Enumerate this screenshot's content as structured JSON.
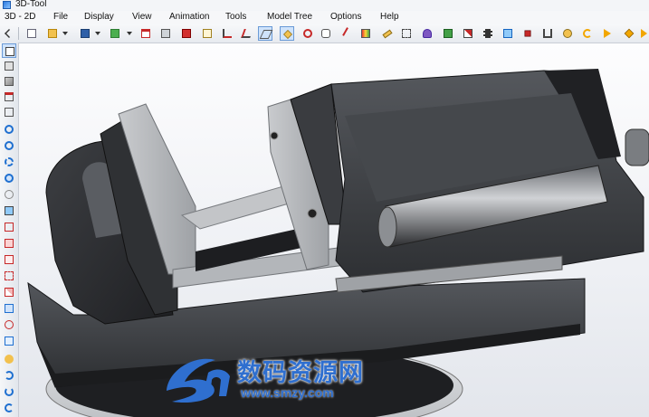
{
  "window": {
    "title": "3D-Tool"
  },
  "menu": [
    {
      "id": "3d2d",
      "label": "3D - 2D"
    },
    {
      "id": "file",
      "label": "File"
    },
    {
      "id": "display",
      "label": "Display"
    },
    {
      "id": "view",
      "label": "View"
    },
    {
      "id": "animation",
      "label": "Animation"
    },
    {
      "id": "tools",
      "label": "Tools"
    },
    {
      "id": "model-tree",
      "label": "Model Tree"
    },
    {
      "id": "options",
      "label": "Options"
    },
    {
      "id": "help",
      "label": "Help"
    }
  ],
  "toolbar": {
    "buttons": [
      {
        "icon": "expand-arrows-icon"
      },
      {
        "icon": "new-document-icon"
      },
      {
        "icon": "open-folder-icon",
        "dropdown": true
      },
      {
        "icon": "save-disk-icon",
        "dropdown": true
      },
      {
        "icon": "export-icon",
        "dropdown": true
      },
      {
        "icon": "pdf-export-icon"
      },
      {
        "icon": "print-icon"
      },
      {
        "icon": "bom-icon"
      },
      {
        "icon": "properties-icon"
      },
      {
        "icon": "measure-edge-icon"
      },
      {
        "icon": "measure-angle-icon"
      },
      {
        "icon": "section-cut-icon",
        "active": true
      },
      {
        "icon": "section-plane-icon",
        "active": true
      },
      {
        "icon": "markup-icon"
      },
      {
        "icon": "comment-icon"
      },
      {
        "icon": "pencil-icon"
      },
      {
        "icon": "color-picker-icon"
      },
      {
        "icon": "ruler-icon"
      },
      {
        "icon": "exploded-view-icon"
      },
      {
        "icon": "paint-brush-icon"
      },
      {
        "icon": "compare-icon"
      },
      {
        "icon": "transform-icon"
      },
      {
        "icon": "film-strip-icon"
      },
      {
        "icon": "snapshot-icon"
      },
      {
        "icon": "assembly-icon"
      },
      {
        "icon": "component-icon"
      },
      {
        "icon": "move-icon"
      },
      {
        "icon": "rotate-icon"
      },
      {
        "icon": "play-forward-icon"
      },
      {
        "icon": "keyframe-diamond-icon"
      },
      {
        "icon": "animation-path-icon"
      }
    ]
  },
  "side_toolbar": {
    "buttons": [
      {
        "icon": "select-icon",
        "selected": true
      },
      {
        "icon": "view-front-icon"
      },
      {
        "icon": "view-iso-icon"
      },
      {
        "icon": "view-top-icon"
      },
      {
        "icon": "view-side-icon"
      },
      {
        "icon": "zoom-in-icon"
      },
      {
        "icon": "zoom-out-icon"
      },
      {
        "icon": "zoom-window-icon"
      },
      {
        "icon": "zoom-fit-icon"
      },
      {
        "icon": "pan-icon"
      },
      {
        "icon": "rotate-view-icon"
      },
      {
        "icon": "cube-wireframe-icon"
      },
      {
        "icon": "cube-shaded-icon"
      },
      {
        "icon": "cube-edges-icon"
      },
      {
        "icon": "cube-hidden-icon"
      },
      {
        "icon": "cube-section-icon"
      },
      {
        "icon": "cube-transparent-icon"
      },
      {
        "icon": "hide-icon"
      },
      {
        "icon": "show-all-icon"
      },
      {
        "icon": "lighting-icon"
      },
      {
        "icon": "rotate-180-x-icon"
      },
      {
        "icon": "rotate-180-y-icon"
      },
      {
        "icon": "rotate-180-z-icon"
      }
    ]
  },
  "viewport": {
    "background": "#eef0f4",
    "model_color": "#3b3d41"
  },
  "watermark": {
    "name": "数码资源网",
    "url": "www.smzy.com"
  }
}
